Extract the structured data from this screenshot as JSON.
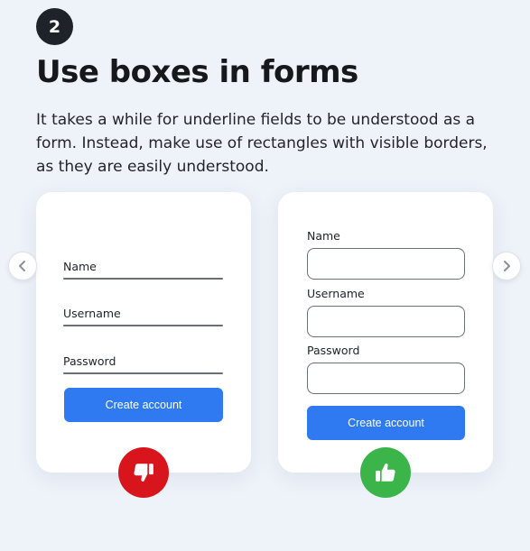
{
  "step": {
    "number": "2"
  },
  "heading": "Use boxes in forms",
  "description": "It takes a while for underline fields to be understood as a form. Instead, make use of rectangles with visible borders, as they are easily understood.",
  "bad_example": {
    "fields": [
      "Name",
      "Username",
      "Password"
    ],
    "button_label": "Create account",
    "badge_icon": "thumbs-down-icon",
    "badge_color": "#d8151c"
  },
  "good_example": {
    "fields": [
      "Name",
      "Username",
      "Password"
    ],
    "button_label": "Create account",
    "badge_icon": "thumbs-up-icon",
    "badge_color": "#3bb54a"
  },
  "colors": {
    "accent": "#2f7af0",
    "background": "#eef2f9",
    "badge": "#1e2229"
  },
  "navigation": {
    "prev_icon": "chevron-left-icon",
    "next_icon": "chevron-right-icon"
  }
}
